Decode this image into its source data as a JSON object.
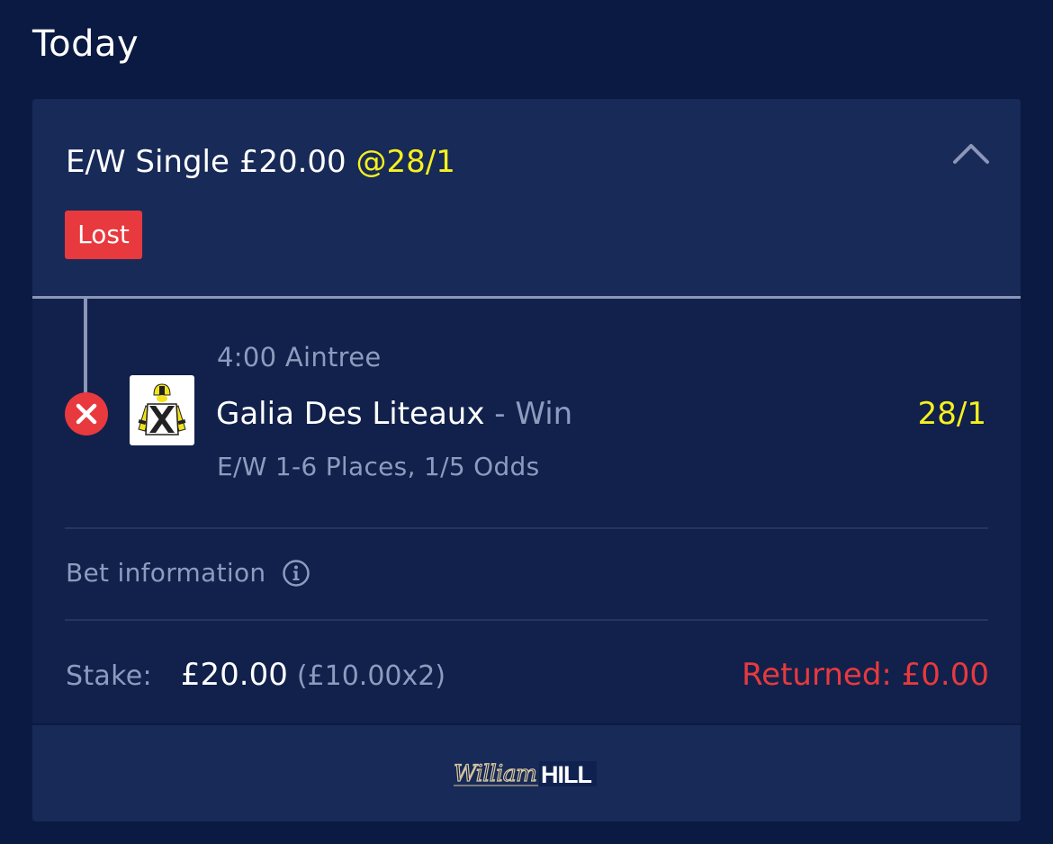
{
  "page": {
    "title": "Today"
  },
  "bet": {
    "type_label": "E/W Single £20.00",
    "odds": "@28/1",
    "status": "Lost",
    "collapse_icon": "chevron-up-icon",
    "selection": {
      "status_icon": "x-circle-icon",
      "race": "4:00 Aintree",
      "runner": "Galia Des Liteaux",
      "market": " - Win",
      "odds": "28/1",
      "terms": "E/W 1-6 Places, 1/5 Odds"
    },
    "info": {
      "label": "Bet information",
      "icon": "info-icon"
    },
    "stake": {
      "label": "Stake:",
      "value": "£20.00",
      "detail": "(£10.00x2)"
    },
    "returned": "Returned: £0.00"
  },
  "footer": {
    "brand_logo": "William HILL"
  },
  "colors": {
    "background": "#0a1a42",
    "card": "#182a57",
    "odds_yellow": "#f6f01e",
    "lost_red": "#e8393e",
    "muted_text": "#8e9bbf"
  }
}
